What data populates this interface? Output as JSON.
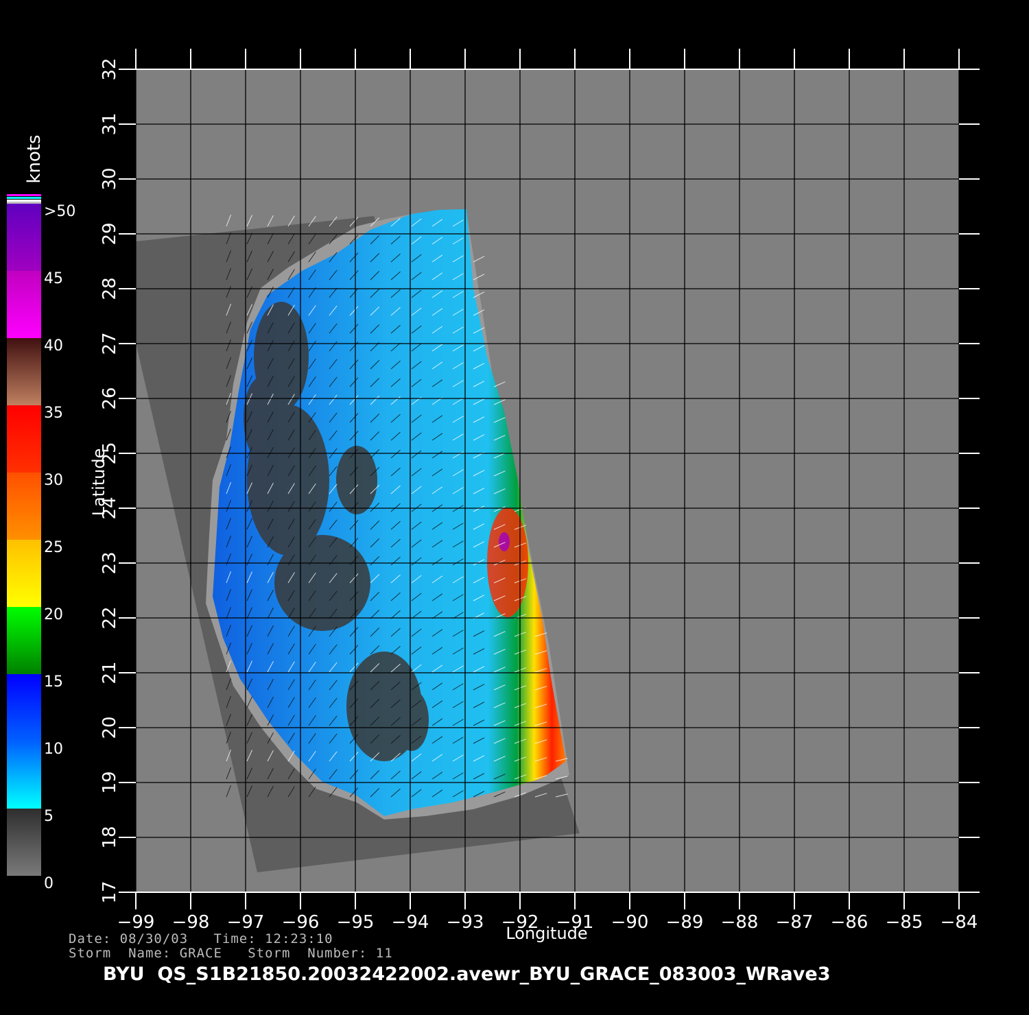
{
  "map": {
    "x_axis_label": "Longitude",
    "y_axis_label": "Latitude",
    "lon_range": [
      -99,
      -84
    ],
    "lat_range": [
      17,
      32
    ],
    "lon_ticks": [
      "-99",
      "-98",
      "-97",
      "-96",
      "-95",
      "-94",
      "-93",
      "-92",
      "-91",
      "-90",
      "-89",
      "-88",
      "-87",
      "-86",
      "-85",
      "-84"
    ],
    "lat_ticks": [
      "17",
      "18",
      "19",
      "20",
      "21",
      "22",
      "23",
      "24",
      "25",
      "26",
      "27",
      "28",
      "29",
      "30",
      "31",
      "32"
    ],
    "background_color": "#808080",
    "land_color": "#5a5a5a"
  },
  "colorbar": {
    "unit": "knots",
    "labels": [
      ">50",
      "45",
      "40",
      "35",
      "30",
      "25",
      "20",
      "15",
      "10",
      "5",
      "0"
    ],
    "stops": [
      {
        "from": 0,
        "to": 5,
        "colors": [
          "#7a7a7a",
          "#2e2e2e"
        ]
      },
      {
        "from": 5,
        "to": 10,
        "colors": [
          "#00ffff",
          "#0060ff"
        ]
      },
      {
        "from": 10,
        "to": 15,
        "colors": [
          "#0060ff",
          "#0000ff"
        ]
      },
      {
        "from": 15,
        "to": 20,
        "colors": [
          "#008000",
          "#00ff00"
        ]
      },
      {
        "from": 20,
        "to": 25,
        "colors": [
          "#ffff00",
          "#ffc000"
        ]
      },
      {
        "from": 25,
        "to": 30,
        "colors": [
          "#ff9000",
          "#ff5000"
        ]
      },
      {
        "from": 30,
        "to": 35,
        "colors": [
          "#ff3000",
          "#ff0000"
        ]
      },
      {
        "from": 35,
        "to": 40,
        "colors": [
          "#c08060",
          "#401010"
        ]
      },
      {
        "from": 40,
        "to": 45,
        "colors": [
          "#ff00ff",
          "#c000c0"
        ]
      },
      {
        "from": 45,
        "to": 50,
        "colors": [
          "#a000c0",
          "#6000c0"
        ]
      }
    ]
  },
  "info": {
    "date_line": "Date: 08/30/03   Time: 12:23:10",
    "storm_line": "Storm  Name: GRACE   Storm  Number: 11",
    "file_title": "BYU  QS_S1B21850.20032422002.avewr_BYU_GRACE_083003_WRave3"
  }
}
